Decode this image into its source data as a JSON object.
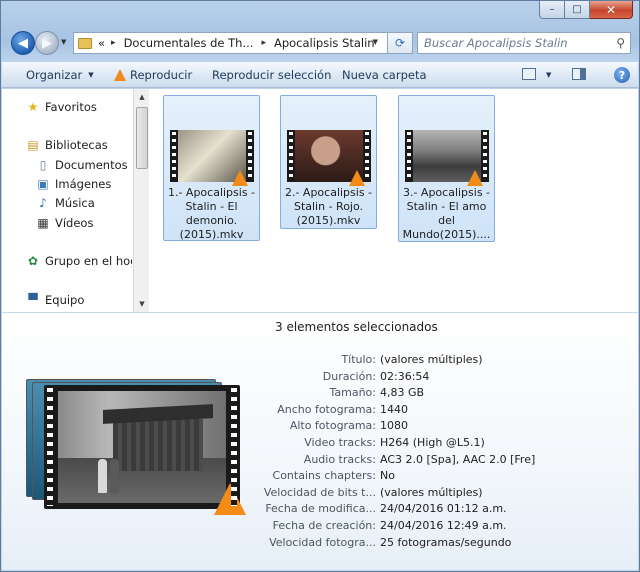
{
  "window": {
    "close_glyph": "✕",
    "max_glyph": "□",
    "min_glyph": "–"
  },
  "address_bar": {
    "overflow": "«",
    "crumbs": [
      "Documentales de Th...",
      "Apocalipsis Stalin"
    ],
    "separator": "▸"
  },
  "search": {
    "placeholder": "Buscar Apocalipsis Stalin"
  },
  "commands": {
    "organize": "Organizar",
    "play": "Reproducir",
    "play_selection": "Reproducir selección",
    "new_folder": "Nueva carpeta"
  },
  "navpane": {
    "favorites": "Favoritos",
    "libraries": "Bibliotecas",
    "documents": "Documentos",
    "images": "Imágenes",
    "music": "Música",
    "videos": "Vídeos",
    "homegroup": "Grupo en el hoga",
    "computer": "Equipo"
  },
  "files": [
    {
      "label": "1.- Apocalipsis - Stalin - El demonio.(2015).mkv"
    },
    {
      "label": "2.- Apocalipsis - Stalin - Rojo.(2015).mkv"
    },
    {
      "label": "3.- Apocalipsis - Stalin - El amo del Mundo(2015)...."
    }
  ],
  "details": {
    "selection_count": "3 elementos seleccionados",
    "properties": [
      {
        "key": "Título:",
        "value": "(valores múltiples)"
      },
      {
        "key": "Duración:",
        "value": "02:36:54"
      },
      {
        "key": "Tamaño:",
        "value": "4,83 GB"
      },
      {
        "key": "Ancho fotograma:",
        "value": "1440"
      },
      {
        "key": "Alto fotograma:",
        "value": "1080"
      },
      {
        "key": "Video tracks:",
        "value": "H264 (High @L5.1)"
      },
      {
        "key": "Audio tracks:",
        "value": "AC3 2.0 [Spa], AAC 2.0 [Fre]"
      },
      {
        "key": "Contains chapters:",
        "value": "No"
      },
      {
        "key": "Velocidad de bits t...",
        "value": "(valores múltiples)"
      },
      {
        "key": "Fecha de modifica...",
        "value": "24/04/2016 01:12 a.m."
      },
      {
        "key": "Fecha de creación:",
        "value": "24/04/2016 12:49 a.m."
      },
      {
        "key": "Velocidad fotogra...",
        "value": "25 fotogramas/segundo"
      }
    ]
  },
  "colors": {
    "selection_fill": "#cfe3f8",
    "selection_border": "#84acdd",
    "vlc_orange": "#f28c16"
  }
}
